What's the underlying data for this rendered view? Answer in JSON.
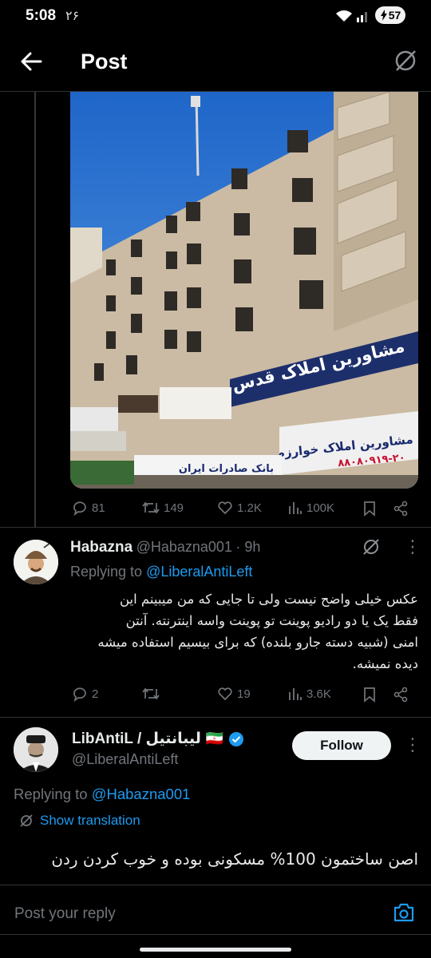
{
  "status_bar": {
    "time": "5:08",
    "sub": "۲۶",
    "battery": "57"
  },
  "header": {
    "title": "Post"
  },
  "main_post": {
    "stats": {
      "replies": "81",
      "reposts": "149",
      "likes": "1.2K",
      "views": "100K"
    },
    "image_text": {
      "sign_top": "مشاورین املاک قدس",
      "sign_bottom": "مشاورین املاک خوارزم",
      "sign_phone": "۸۸۰۸۰۹۱۹-۲۰",
      "bank": "بانک صادرات ایران"
    }
  },
  "reply1": {
    "name": "Habazna",
    "handle": "@Habazna001",
    "time": "· 9h",
    "replying_label": "Replying to",
    "replying_to": "@LiberalAntiLeft",
    "text_lines": [
      "عکس خیلی واضح نیست ولی تا جایی که من میبینم این",
      "فقط یک یا دو رادیو پوینت تو پوینت واسه اینترنته. آنتن",
      "امنی (شبیه دسته جارو بلنده) که برای بیسیم استفاده میشه",
      "دیده نمیشه."
    ],
    "stats": {
      "replies": "2",
      "reposts": "",
      "likes": "19",
      "views": "3.6K"
    }
  },
  "reply2": {
    "name": "LibAntiL / لیبانتیل",
    "flag": "🇮🇷",
    "handle": "@LiberalAntiLeft",
    "follow_label": "Follow",
    "replying_label": "Replying to",
    "replying_to": "@Habazna001",
    "show_translation": "Show translation",
    "text": "اصن ساختمون 100% مسکونی بوده و خوب کردن ردن"
  },
  "compose": {
    "placeholder": "Post your reply"
  },
  "colors": {
    "accent": "#1d9bf0",
    "muted": "#71767b",
    "background": "#000000"
  }
}
